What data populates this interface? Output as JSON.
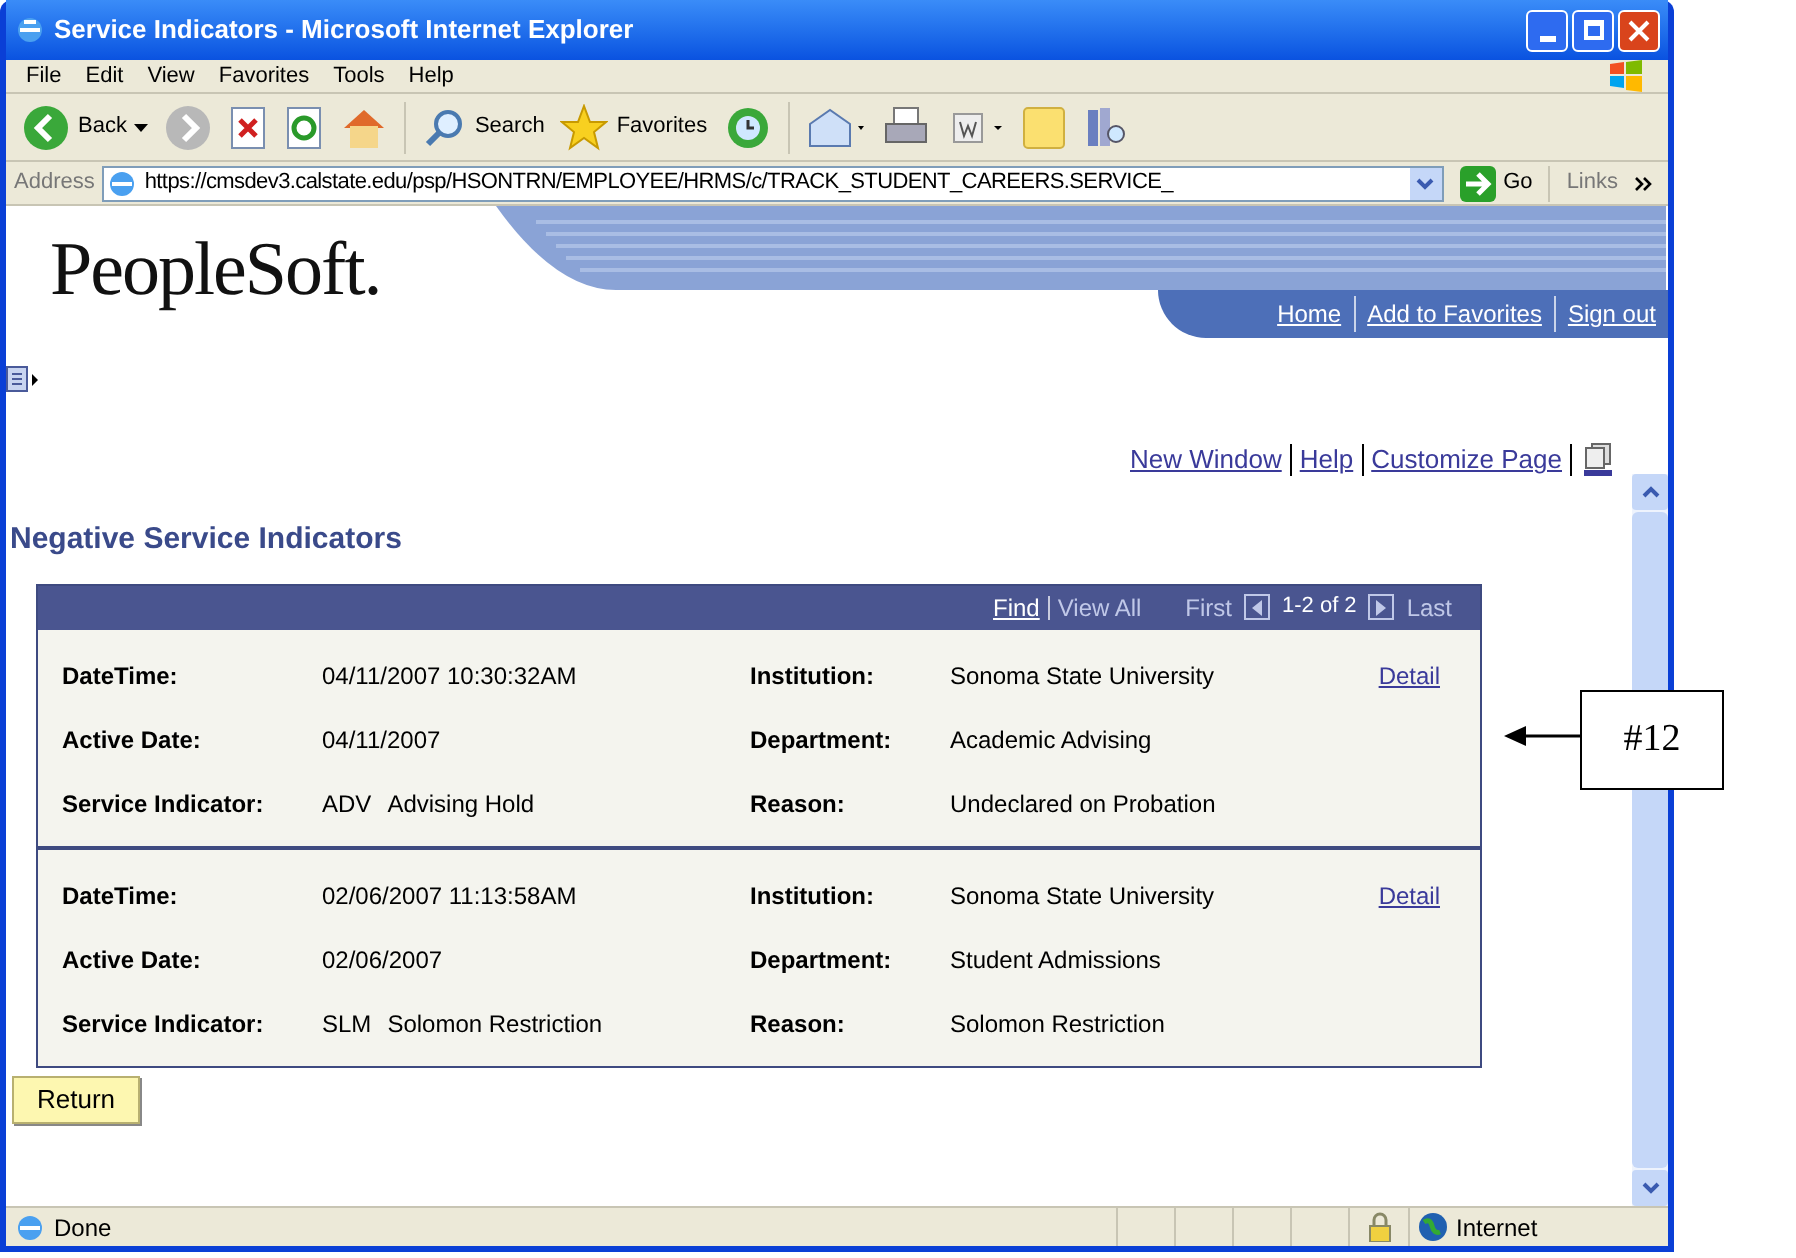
{
  "window": {
    "title": "Service Indicators - Microsoft Internet Explorer"
  },
  "menu": [
    "File",
    "Edit",
    "View",
    "Favorites",
    "Tools",
    "Help"
  ],
  "toolbar": {
    "back": "Back",
    "search": "Search",
    "favorites": "Favorites"
  },
  "address_bar": {
    "label": "Address",
    "url": "https://cmsdev3.calstate.edu/psp/HSONTRN/EMPLOYEE/HRMS/c/TRACK_STUDENT_CAREERS.SERVICE_",
    "go": "Go",
    "links": "Links"
  },
  "header": {
    "logo": "PeopleSoft.",
    "links": [
      "Home",
      "Add to Favorites",
      "Sign out"
    ]
  },
  "page_links": [
    "New Window",
    "Help",
    "Customize Page"
  ],
  "page_title": "Negative Service Indicators",
  "grid_nav": {
    "find": "Find",
    "view_all": "View All",
    "first": "First",
    "range": "1-2 of 2",
    "last": "Last"
  },
  "records": [
    {
      "left": [
        {
          "label": "DateTime:",
          "value": "04/11/2007 10:30:32AM"
        },
        {
          "label": "Active Date:",
          "value": "04/11/2007"
        },
        {
          "label": "Service Indicator:",
          "code": "ADV",
          "value": "Advising Hold"
        }
      ],
      "right": [
        {
          "label": "Institution:",
          "value": "Sonoma State University"
        },
        {
          "label": "Department:",
          "value": "Academic Advising"
        },
        {
          "label": "Reason:",
          "value": "Undeclared on Probation"
        }
      ],
      "detail": "Detail"
    },
    {
      "left": [
        {
          "label": "DateTime:",
          "value": "02/06/2007 11:13:58AM"
        },
        {
          "label": "Active Date:",
          "value": "02/06/2007"
        },
        {
          "label": "Service Indicator:",
          "code": "SLM",
          "value": "Solomon Restriction"
        }
      ],
      "right": [
        {
          "label": "Institution:",
          "value": "Sonoma State University"
        },
        {
          "label": "Department:",
          "value": "Student Admissions"
        },
        {
          "label": "Reason:",
          "value": "Solomon Restriction"
        }
      ],
      "detail": "Detail"
    }
  ],
  "return_button": "Return",
  "status_bar": {
    "status": "Done",
    "zone": "Internet"
  },
  "annotation": {
    "label": "#12"
  }
}
